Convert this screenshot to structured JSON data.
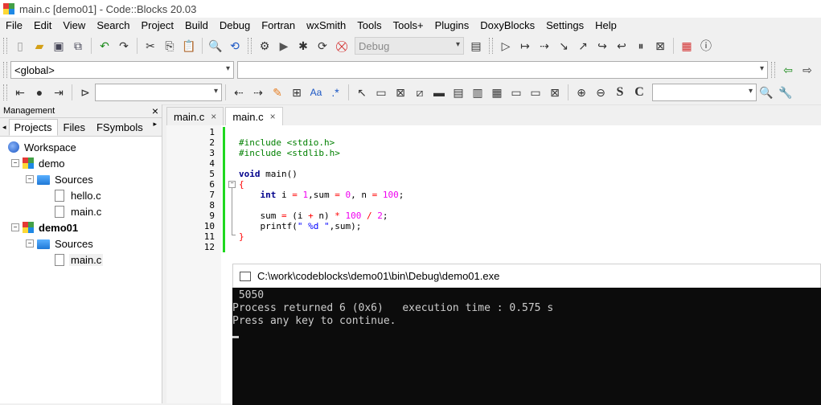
{
  "window": {
    "title": "main.c [demo01] - Code::Blocks 20.03"
  },
  "menu": [
    "File",
    "Edit",
    "View",
    "Search",
    "Project",
    "Build",
    "Debug",
    "Fortran",
    "wxSmith",
    "Tools",
    "Tools+",
    "Plugins",
    "DoxyBlocks",
    "Settings",
    "Help"
  ],
  "toolbar": {
    "build_target": "Debug",
    "scope_combo": "<global>",
    "function_combo": "",
    "search_combo": "",
    "right_search_combo": ""
  },
  "management": {
    "title": "Management",
    "close": "×",
    "tabs": [
      "Projects",
      "Files",
      "FSymbols"
    ],
    "tree": [
      {
        "label": "Workspace"
      },
      {
        "label": "demo"
      },
      {
        "label": "Sources"
      },
      {
        "label": "hello.c"
      },
      {
        "label": "main.c"
      },
      {
        "label": "demo01"
      },
      {
        "label": "Sources"
      },
      {
        "label": "main.c"
      }
    ]
  },
  "editor": {
    "tabs": [
      {
        "label": "main.c",
        "close": "×"
      },
      {
        "label": "main.c",
        "close": "×"
      }
    ],
    "line_numbers": [
      "1",
      "2",
      "3",
      "4",
      "5",
      "6",
      "7",
      "8",
      "9",
      "10",
      "11",
      "12"
    ]
  },
  "console": {
    "title": "C:\\work\\codeblocks\\demo01\\bin\\Debug\\demo01.exe",
    "lines": [
      " 5050",
      "Process returned 6 (0x6)   execution time : 0.575 s",
      "Press any key to continue."
    ]
  },
  "colors": {
    "change_bar": "#1fd81f",
    "preprocessor": "#008000",
    "keyword": "#00008b",
    "number": "#f000f0",
    "console_bg": "#0c0c0c"
  }
}
